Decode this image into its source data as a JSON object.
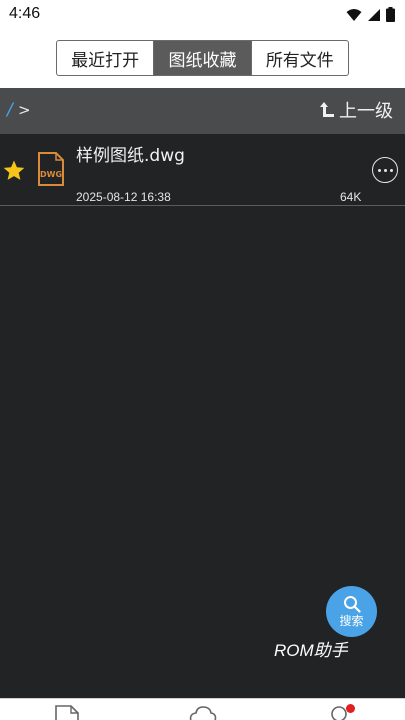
{
  "status_bar": {
    "time": "4:46"
  },
  "tabs": [
    {
      "label": "最近打开",
      "active": false
    },
    {
      "label": "图纸收藏",
      "active": true
    },
    {
      "label": "所有文件",
      "active": false
    }
  ],
  "path_bar": {
    "root": "/",
    "separator": ">",
    "up_label": "上一级"
  },
  "files": [
    {
      "name": "样例图纸.dwg",
      "date": "2025-08-12 16:38",
      "size": "64K",
      "type": "DWG",
      "starred": true
    }
  ],
  "fab": {
    "label": "搜索",
    "icon": "search-icon"
  },
  "watermark": "ROM助手",
  "colors": {
    "accent": "#4aa3e6",
    "star": "#f5c518",
    "dwg_icon": "#d98a3a",
    "badge": "#e02020"
  }
}
